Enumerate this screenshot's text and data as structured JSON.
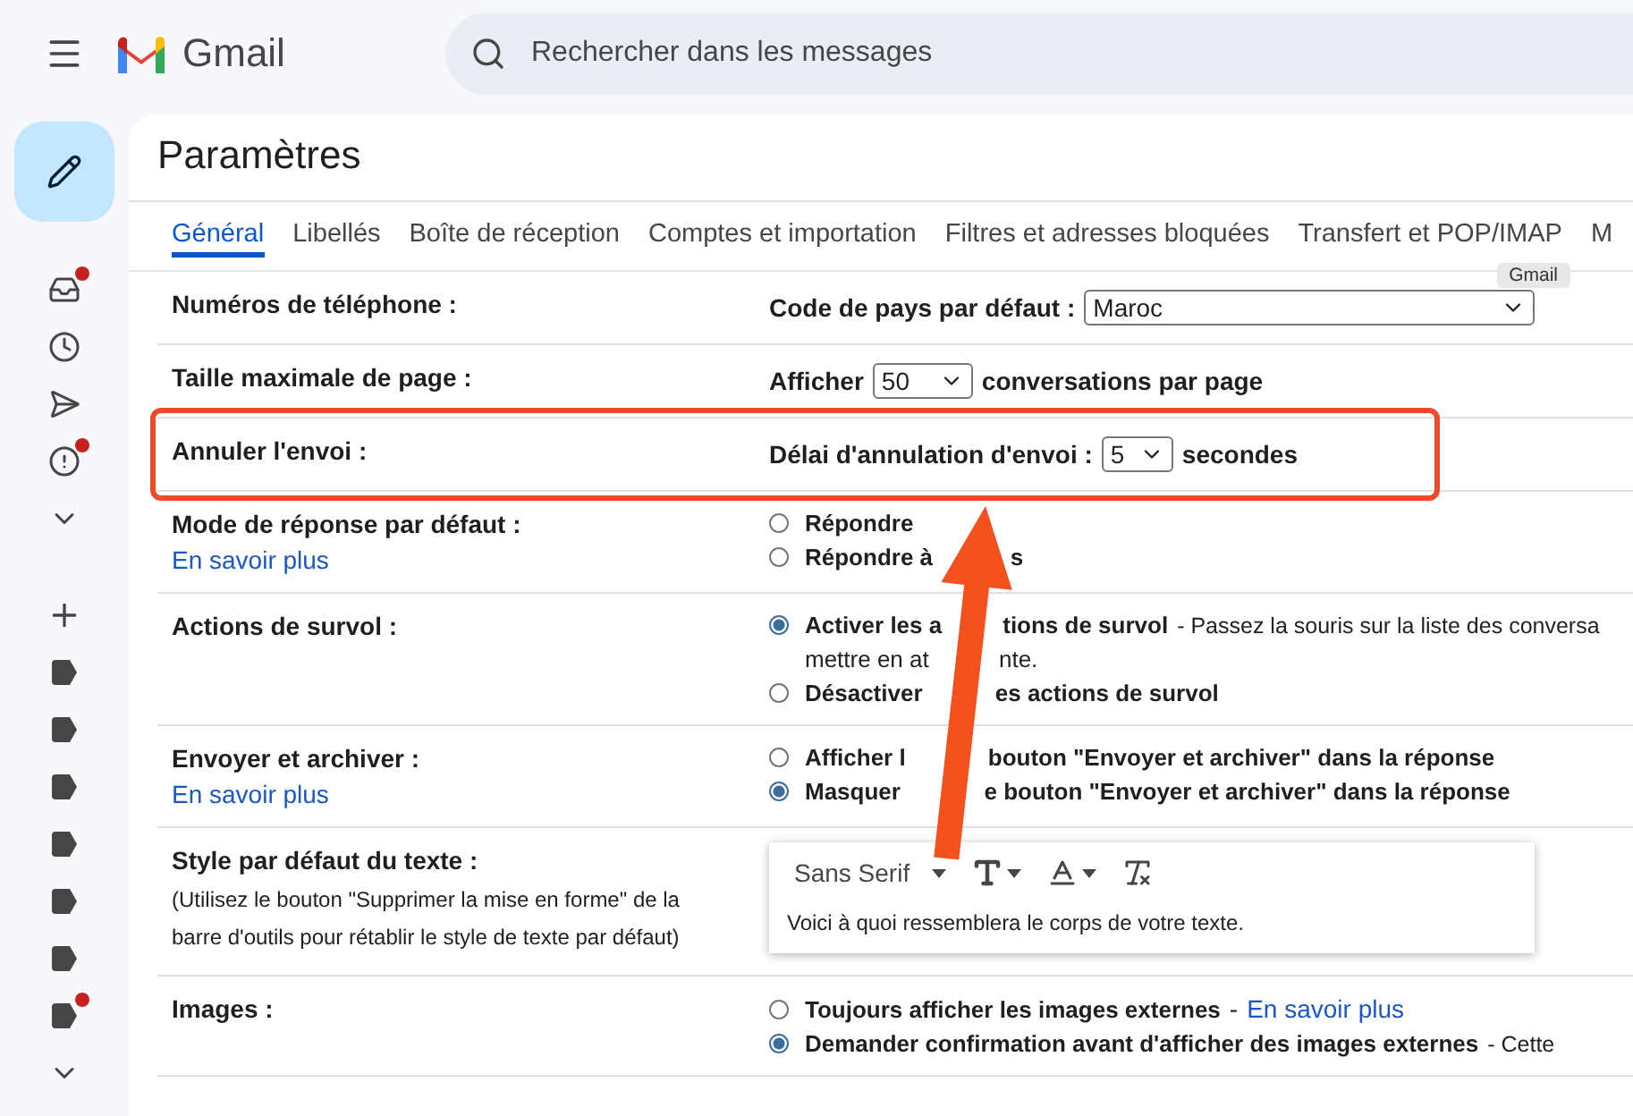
{
  "header": {
    "logo_text": "Gmail",
    "search_placeholder": "Rechercher dans les messages"
  },
  "nav": {
    "top": [
      {
        "kind": "inbox",
        "badge": true
      },
      {
        "kind": "clock",
        "badge": false
      },
      {
        "kind": "send",
        "badge": false
      },
      {
        "kind": "important",
        "badge": true
      },
      {
        "kind": "more",
        "badge": false
      }
    ],
    "labels": [
      {
        "badge": false
      },
      {
        "badge": false
      },
      {
        "badge": false
      },
      {
        "badge": false
      },
      {
        "badge": false
      },
      {
        "badge": false
      },
      {
        "badge": true
      }
    ]
  },
  "settings": {
    "title": "Paramètres",
    "tabs": [
      {
        "label": "Général",
        "selected": true
      },
      {
        "label": "Libellés",
        "selected": false
      },
      {
        "label": "Boîte de réception",
        "selected": false
      },
      {
        "label": "Comptes et importation",
        "selected": false
      },
      {
        "label": "Filtres et adresses bloquées",
        "selected": false
      },
      {
        "label": "Transfert et POP/IMAP",
        "selected": false
      },
      {
        "label": "M",
        "selected": false
      }
    ],
    "tooltip": "Gmail",
    "rows": [
      {
        "label": "Numéros de téléphone :",
        "kind": "select",
        "prefix": "Code de pays par défaut :",
        "value": "Maroc",
        "highlighted": false
      },
      {
        "label": "Taille maximale de page :",
        "kind": "select",
        "prefix": "Afficher",
        "value": "50",
        "suffix": "conversations par page",
        "highlighted": false
      },
      {
        "label": "Annuler l'envoi :",
        "kind": "select",
        "prefix": "Délai d'annulation d'envoi :",
        "value": "5",
        "suffix": "secondes",
        "highlighted": true
      },
      {
        "label": "Mode de réponse par défaut :",
        "link": "En savoir plus",
        "kind": "radio",
        "options": [
          {
            "parts": [
              "Répondre"
            ],
            "selected": false
          },
          {
            "parts": [
              "Répondre à",
              "s"
            ],
            "selected": false
          }
        ]
      },
      {
        "label": "Actions de survol :",
        "kind": "radio",
        "options": [
          {
            "parts": [
              "Activer les a",
              "tions de survol"
            ],
            "description": "- Passez la souris sur la liste des conversa",
            "continuation": [
              "mettre en at",
              "nte."
            ],
            "selected": true
          },
          {
            "parts": [
              "Désactiver",
              "es actions de survol"
            ],
            "selected": false
          }
        ]
      },
      {
        "label": "Envoyer et archiver :",
        "link": "En savoir plus",
        "kind": "radio",
        "options": [
          {
            "parts": [
              "Afficher l",
              "bouton \"Envoyer et archiver\" dans la réponse"
            ],
            "selected": false
          },
          {
            "parts": [
              "Masquer",
              "e bouton \"Envoyer et archiver\" dans la réponse"
            ],
            "selected": true
          }
        ]
      },
      {
        "label": "Style par défaut du texte :",
        "note": "(Utilisez le bouton \"Supprimer la mise en forme\" de la barre d'outils pour rétablir le style de texte par défaut)",
        "kind": "text_style",
        "font": "Sans Serif",
        "sample": "Voici à quoi ressemblera le corps de votre texte."
      },
      {
        "label": "Images :",
        "kind": "radio",
        "options": [
          {
            "parts": [
              "Toujours afficher les images externes"
            ],
            "separator": "-",
            "option_link": "En savoir plus",
            "selected": false
          },
          {
            "parts": [
              "Demander confirmation avant d'afficher des images externes"
            ],
            "description": "- Cette",
            "selected": true
          }
        ]
      }
    ]
  },
  "arrow": true
}
